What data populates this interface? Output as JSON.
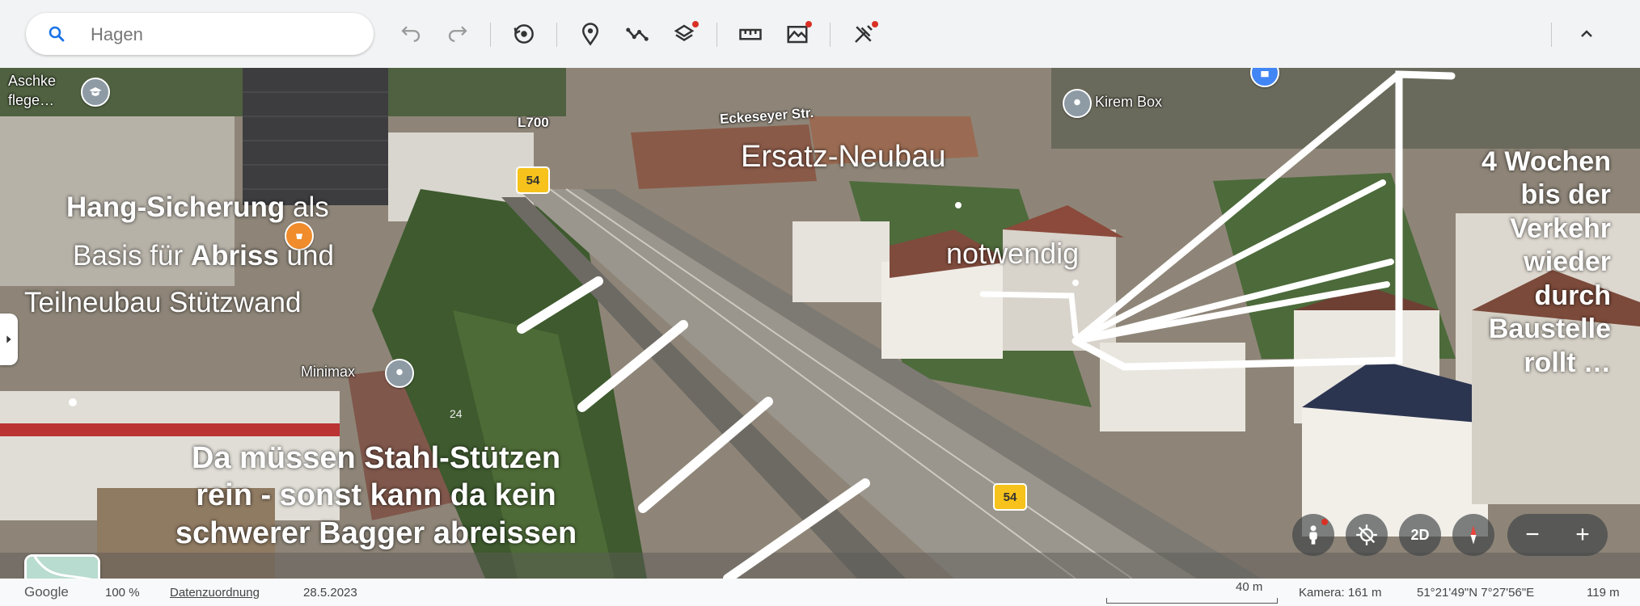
{
  "search": {
    "placeholder": "Hagen"
  },
  "toolbar": {
    "tools": [
      "undo-icon",
      "redo-icon",
      "history-icon",
      "placemark-icon",
      "path-icon",
      "layers-icon",
      "ruler-icon",
      "terrain-icon",
      "tools-icon"
    ],
    "dot_color": "#d93025"
  },
  "map": {
    "places": {
      "aschke_line1": "Aschke",
      "aschke_line2": "flege…",
      "l700": "L700",
      "eckeseyer": "Eckeseyer Str.",
      "kirem": "Kirem Box",
      "minimax": "Minimax",
      "b54_top": "54",
      "b54_bottom": "54",
      "house_24": "24"
    },
    "annotations": {
      "hang_bold1": "Hang-Sicherung",
      "hang_rest1": " als",
      "hang_line2a": "Basis für ",
      "hang_bold2": "Abriss",
      "hang_line2b": " und",
      "hang_line3": "Teilneubau Stützwand",
      "ersatz": "Ersatz-Neubau",
      "notwendig": "notwendig",
      "wochen": [
        "4 Wochen",
        "bis der",
        "Verkehr",
        "wieder",
        "durch",
        "Baustelle",
        "rollt …"
      ],
      "stahl": [
        "Da müssen Stahl-Stützen",
        "rein - sonst kann da kein",
        "schwerer Bagger abreissen"
      ]
    },
    "controls": {
      "streetview": "streetview-icon",
      "locate": "locate-icon",
      "mode_2d": "2D",
      "compass": "compass-icon",
      "zoom_out": "−",
      "zoom_in": "+"
    }
  },
  "footer": {
    "brand": "Google",
    "zoom": "100 %",
    "attribution": "Datenzuordnung",
    "date": "28.5.2023",
    "scale": "40 m",
    "camera": "Kamera: 161 m",
    "coords": "51°21'49\"N 7°27'56\"E",
    "elevation": "119 m"
  },
  "colors": {
    "accent": "#1a73e8",
    "shield": "#f6c21b",
    "pin_grey": "#8e9ba5",
    "pin_orange": "#f08c2c",
    "pin_blue": "#4285f4"
  }
}
